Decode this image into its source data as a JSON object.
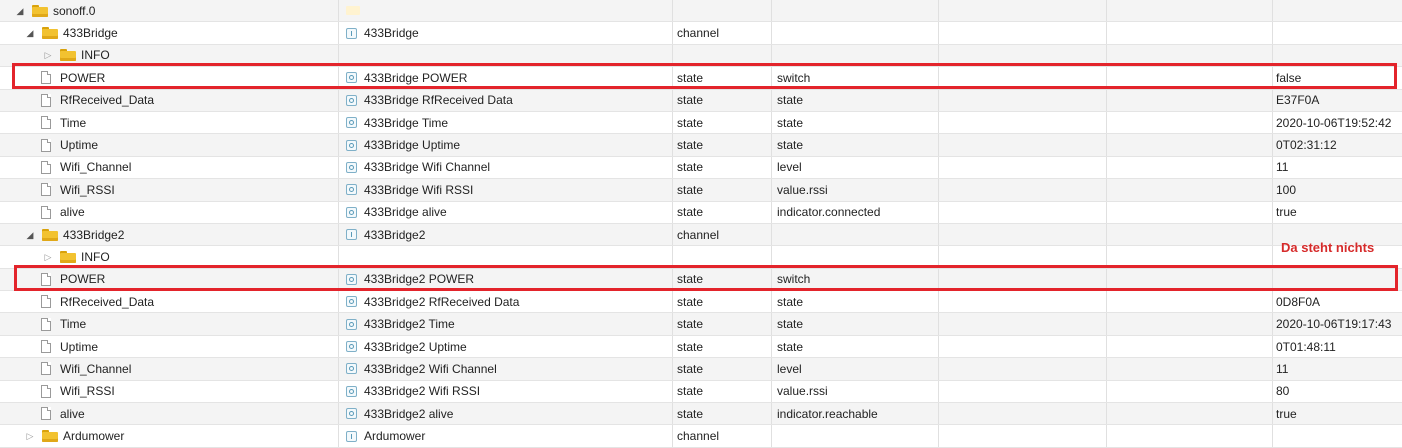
{
  "annotation": "Da steht nichts",
  "rows": [
    {
      "depth": 0,
      "toggle": "open",
      "icon": "folder",
      "name": "sonoff.0",
      "title_icon": "adapter",
      "title": "",
      "type": "",
      "role": "",
      "value": ""
    },
    {
      "depth": 1,
      "toggle": "open",
      "icon": "folder",
      "name": "433Bridge",
      "title_icon": "channel",
      "title": "433Bridge",
      "type": "channel",
      "role": "",
      "value": ""
    },
    {
      "depth": 2,
      "toggle": "closed",
      "icon": "folder",
      "name": "INFO",
      "title_icon": "",
      "title": "",
      "type": "",
      "role": "",
      "value": ""
    },
    {
      "depth": 2,
      "toggle": "",
      "icon": "file",
      "name": "POWER",
      "title_icon": "state",
      "title": "433Bridge POWER",
      "type": "state",
      "role": "switch",
      "value": "false"
    },
    {
      "depth": 2,
      "toggle": "",
      "icon": "file",
      "name": "RfReceived_Data",
      "title_icon": "state",
      "title": "433Bridge RfReceived Data",
      "type": "state",
      "role": "state",
      "value": "E37F0A"
    },
    {
      "depth": 2,
      "toggle": "",
      "icon": "file",
      "name": "Time",
      "title_icon": "state",
      "title": "433Bridge Time",
      "type": "state",
      "role": "state",
      "value": "2020-10-06T19:52:42"
    },
    {
      "depth": 2,
      "toggle": "",
      "icon": "file",
      "name": "Uptime",
      "title_icon": "state",
      "title": "433Bridge Uptime",
      "type": "state",
      "role": "state",
      "value": "0T02:31:12"
    },
    {
      "depth": 2,
      "toggle": "",
      "icon": "file",
      "name": "Wifi_Channel",
      "title_icon": "state",
      "title": "433Bridge Wifi Channel",
      "type": "state",
      "role": "level",
      "value": "11"
    },
    {
      "depth": 2,
      "toggle": "",
      "icon": "file",
      "name": "Wifi_RSSI",
      "title_icon": "state",
      "title": "433Bridge Wifi RSSI",
      "type": "state",
      "role": "value.rssi",
      "value": "100"
    },
    {
      "depth": 2,
      "toggle": "",
      "icon": "file",
      "name": "alive",
      "title_icon": "state",
      "title": "433Bridge alive",
      "type": "state",
      "role": "indicator.connected",
      "value": "true"
    },
    {
      "depth": 1,
      "toggle": "open",
      "icon": "folder",
      "name": "433Bridge2",
      "title_icon": "channel",
      "title": "433Bridge2",
      "type": "channel",
      "role": "",
      "value": ""
    },
    {
      "depth": 2,
      "toggle": "closed",
      "icon": "folder",
      "name": "INFO",
      "title_icon": "",
      "title": "",
      "type": "",
      "role": "",
      "value": ""
    },
    {
      "depth": 2,
      "toggle": "",
      "icon": "file",
      "name": "POWER",
      "title_icon": "state",
      "title": "433Bridge2 POWER",
      "type": "state",
      "role": "switch",
      "value": ""
    },
    {
      "depth": 2,
      "toggle": "",
      "icon": "file",
      "name": "RfReceived_Data",
      "title_icon": "state",
      "title": "433Bridge2 RfReceived Data",
      "type": "state",
      "role": "state",
      "value": "0D8F0A"
    },
    {
      "depth": 2,
      "toggle": "",
      "icon": "file",
      "name": "Time",
      "title_icon": "state",
      "title": "433Bridge2 Time",
      "type": "state",
      "role": "state",
      "value": "2020-10-06T19:17:43"
    },
    {
      "depth": 2,
      "toggle": "",
      "icon": "file",
      "name": "Uptime",
      "title_icon": "state",
      "title": "433Bridge2 Uptime",
      "type": "state",
      "role": "state",
      "value": "0T01:48:11"
    },
    {
      "depth": 2,
      "toggle": "",
      "icon": "file",
      "name": "Wifi_Channel",
      "title_icon": "state",
      "title": "433Bridge2 Wifi Channel",
      "type": "state",
      "role": "level",
      "value": "11"
    },
    {
      "depth": 2,
      "toggle": "",
      "icon": "file",
      "name": "Wifi_RSSI",
      "title_icon": "state",
      "title": "433Bridge2 Wifi RSSI",
      "type": "state",
      "role": "value.rssi",
      "value": "80"
    },
    {
      "depth": 2,
      "toggle": "",
      "icon": "file",
      "name": "alive",
      "title_icon": "state",
      "title": "433Bridge2 alive",
      "type": "state",
      "role": "indicator.reachable",
      "value": "true"
    },
    {
      "depth": 1,
      "toggle": "closed",
      "icon": "folder",
      "name": "Ardumower",
      "title_icon": "channel",
      "title": "Ardumower",
      "type": "channel",
      "role": "",
      "value": ""
    }
  ],
  "highlight_color": "#e3242b"
}
